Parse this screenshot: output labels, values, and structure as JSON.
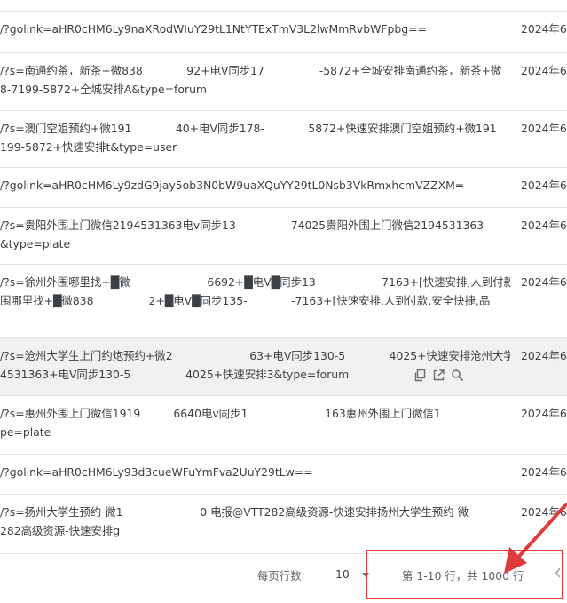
{
  "rows": [
    {
      "lines": [
        "/?golink=aHR0cHM6Ly9naXRodWIuY29tL1NtYTExTmV3L2lwMmRvbWFpbg=="
      ],
      "date": "2024年6"
    },
    {
      "lines": [
        "/?s=南通约茶，新茶+微838　　　　92+电V同步17　　　　　-5872+全城安排南通约茶，新茶+微",
        "8-7199-5872+全城安排A&type=forum"
      ],
      "date": "2024年6"
    },
    {
      "lines": [
        "/?s=澳门空姐预约+微191　　　　40+电V同步178-　　　　5872+快速安排澳门空姐预约+微191",
        "199-5872+快速安排t&type=user"
      ],
      "date": "2024年6"
    },
    {
      "lines": [
        "/?golink=aHR0cHM6Ly9zdG9jay5ob3N0bW9uaXQuYY29tL0Nsb3VkRmxhcmVZZXM="
      ],
      "date": "2024年6"
    },
    {
      "lines": [
        "/?s=贵阳外围上门微信2194531363电v同步13　　　　　74025贵阳外围上门微信2194531363",
        "&type=plate"
      ],
      "date": "2024年6"
    },
    {
      "lines": [
        "/?s=徐州外围哪里找+█微　　　　　　　6692+█电V█同步13　　　　　　7163+[快速安排,人到付款,安",
        "围哪里找+█微838　　　　　2+█电V█同步135-　　　　-7163+[快速安排,人到付款,安全快捷,品"
      ],
      "date": "2024年6"
    },
    {
      "lines": [
        "/?s=沧州大学生上门约炮预约+微2　　　　　　　63+电V同步130-5　　　　4025+快速安排沧州大学",
        "4531363+电V同步130-5　　　　　4025+快速安排3&type=forum"
      ],
      "date": "2024年6"
    },
    {
      "lines": [
        "/?s=惠州外围上门微信1919　　　6640电v同步1　　　　　　　163惠州外围上门微信1　　　　　　　　　电v",
        "pe=plate"
      ],
      "date": "2024年6"
    },
    {
      "lines": [
        "/?golink=aHR0cHM6Ly93d3cueWFuYmFva2UuY29tLw=="
      ],
      "date": "2024年6"
    },
    {
      "lines": [
        "/?s=扬州大学生预约 微1　　　　　　　0 电报@VTT282高级资源-快速安排扬州大学生预约 微",
        "282高级资源-快速安排g"
      ],
      "date": "2024年6"
    }
  ],
  "footer": {
    "rows_per_page_label": "每页行数:",
    "rows_per_page_value": "10",
    "range_text": "第 1-10 行，共 1000 行"
  },
  "colors": {
    "accent_annotation": "#e03a3a",
    "highlight_row": "#f1f1f1"
  }
}
